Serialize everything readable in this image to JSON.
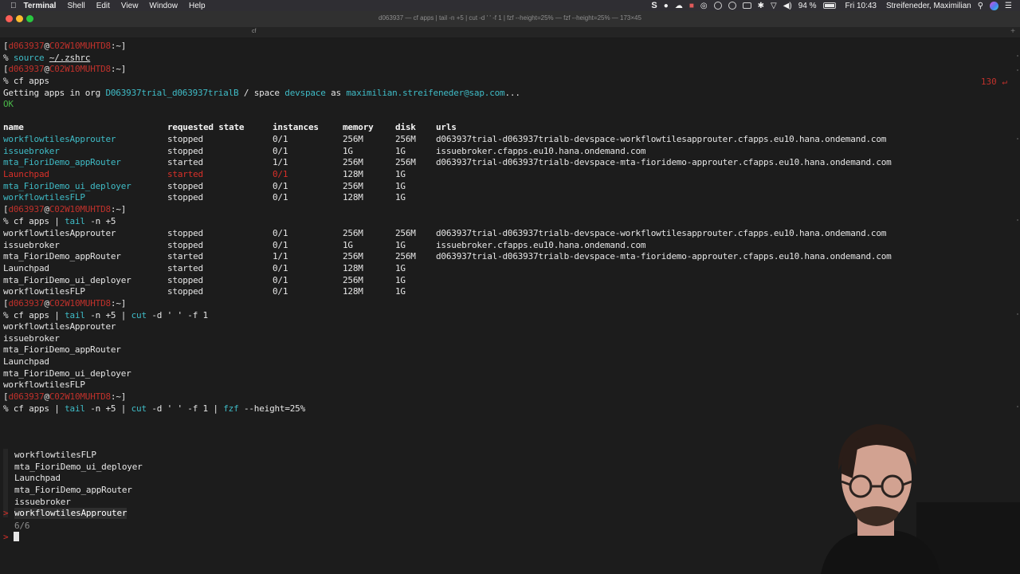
{
  "menubar": {
    "app_name": "Terminal",
    "menus": [
      "Shell",
      "Edit",
      "View",
      "Window",
      "Help"
    ],
    "battery": "94 %",
    "clock": "Fri 10:43",
    "user": "Streifeneder, Maximilian"
  },
  "window": {
    "title": "d063937 — cf apps | tail -n +5 | cut -d ' ' -f 1 | fzf --height=25% — fzf --height=25% — 173×45",
    "tab_label": "cf",
    "tab_add": "+"
  },
  "prompt": {
    "user": "d063937",
    "host": "C02W10MUHTD8",
    "path": "~",
    "symbol": "%"
  },
  "commands": {
    "c1": "source",
    "c1_arg": "~/.zshrc",
    "c2": "cf apps",
    "c3_a": "cf apps | ",
    "c3_b": "tail",
    "c3_c": " -n +5",
    "c4_a": "cf apps | ",
    "c4_b": "tail",
    "c4_c": " -n +5 | ",
    "c4_d": "cut",
    "c4_e": " -d ' ' -f 1",
    "c5_a": "cf apps | ",
    "c5_b": "tail",
    "c5_c": " -n +5 | ",
    "c5_d": "cut",
    "c5_e": " -d ' ' -f 1 | ",
    "c5_f": "fzf",
    "c5_g": " --height=25%"
  },
  "return_code": "130 ↵",
  "getting": {
    "prefix": "Getting apps in org ",
    "org": "D063937trial_d063937trialB",
    "mid": " / space ",
    "space": "devspace",
    "as": " as ",
    "email": "maximilian.streifeneder@sap.com",
    "suffix": "...",
    "ok": "OK"
  },
  "table": {
    "headers": [
      "name",
      "requested state",
      "instances",
      "memory",
      "disk",
      "urls"
    ],
    "rows": [
      {
        "name": "workflowtilesApprouter",
        "state": "stopped",
        "instances": "0/1",
        "memory": "256M",
        "disk": "256M",
        "url": "d063937trial-d063937trialb-devspace-workflowtilesapprouter.cfapps.eu10.hana.ondemand.com"
      },
      {
        "name": "issuebroker",
        "state": "stopped",
        "instances": "0/1",
        "memory": "1G",
        "disk": "1G",
        "url": "issuebroker.cfapps.eu10.hana.ondemand.com"
      },
      {
        "name": "mta_FioriDemo_appRouter",
        "state": "started",
        "instances": "1/1",
        "memory": "256M",
        "disk": "256M",
        "url": "d063937trial-d063937trialb-devspace-mta-fioridemo-approuter.cfapps.eu10.hana.ondemand.com"
      },
      {
        "name": "Launchpad",
        "state": "started",
        "instances": "0/1",
        "memory": "128M",
        "disk": "1G",
        "url": ""
      },
      {
        "name": "mta_FioriDemo_ui_deployer",
        "state": "stopped",
        "instances": "0/1",
        "memory": "256M",
        "disk": "1G",
        "url": ""
      },
      {
        "name": "workflowtilesFLP",
        "state": "stopped",
        "instances": "0/1",
        "memory": "128M",
        "disk": "1G",
        "url": ""
      }
    ]
  },
  "cut_output": [
    "workflowtilesApprouter",
    "issuebroker",
    "mta_FioriDemo_appRouter",
    "Launchpad",
    "mta_FioriDemo_ui_deployer",
    "workflowtilesFLP"
  ],
  "fzf": {
    "items": [
      "workflowtilesFLP",
      "mta_FioriDemo_ui_deployer",
      "Launchpad",
      "mta_FioriDemo_appRouter",
      "issuebroker",
      "workflowtilesApprouter"
    ],
    "selected_index": 5,
    "pointer": ">",
    "count": "6/6",
    "prompt": ">"
  }
}
